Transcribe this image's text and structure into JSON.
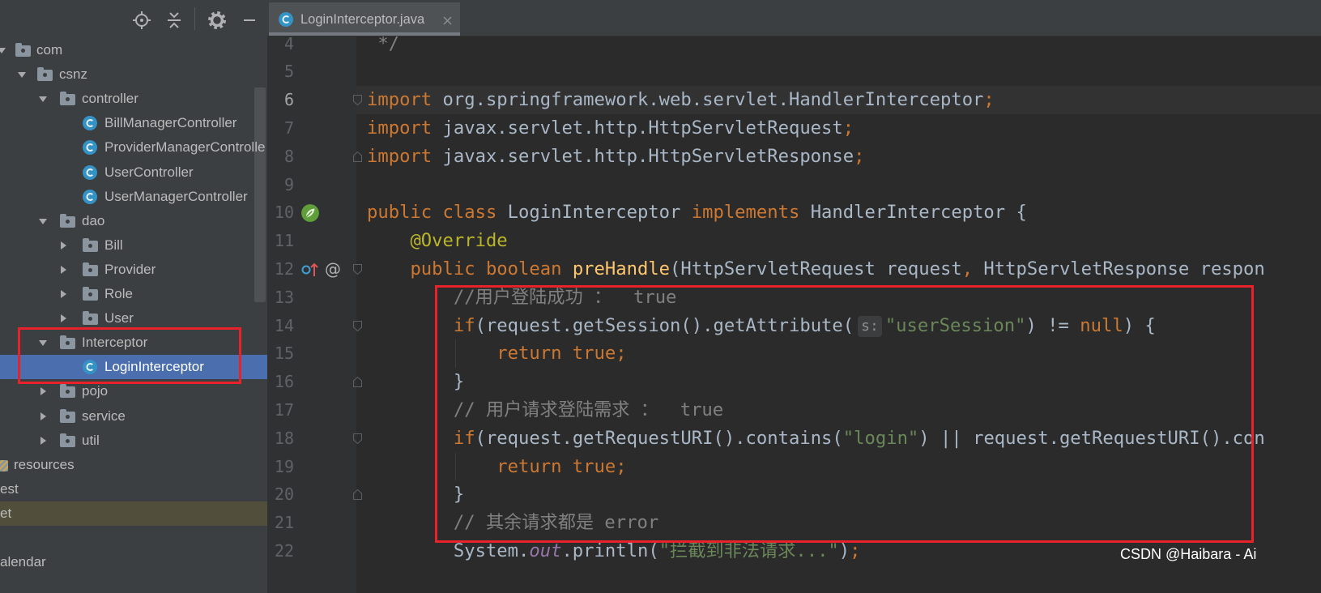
{
  "colors": {
    "keyword": "#cc7832",
    "plain": "#a9b7c6",
    "string": "#6a8759",
    "comment": "#808080",
    "annotation": "#bbb529",
    "method_decl": "#ffc66d",
    "static_field": "#9876aa",
    "selection": "#4b6eaf",
    "highlight_box": "#e8222b"
  },
  "project_panel": {
    "toolbar_icons": [
      "locate-icon",
      "collapse-all-icon",
      "gear-icon",
      "hide-icon"
    ],
    "tree": [
      {
        "label": "com",
        "kind": "package",
        "depth": 0,
        "expanded": true
      },
      {
        "label": "csnz",
        "kind": "package",
        "depth": 1,
        "expanded": true
      },
      {
        "label": "controller",
        "kind": "package",
        "depth": 2,
        "expanded": true
      },
      {
        "label": "BillManagerController",
        "kind": "class",
        "depth": 3
      },
      {
        "label": "ProviderManagerControlle",
        "kind": "class",
        "depth": 3
      },
      {
        "label": "UserController",
        "kind": "class",
        "depth": 3
      },
      {
        "label": "UserManagerController",
        "kind": "class",
        "depth": 3
      },
      {
        "label": "dao",
        "kind": "package",
        "depth": 2,
        "expanded": true
      },
      {
        "label": "Bill",
        "kind": "package",
        "depth": 3,
        "expanded": false
      },
      {
        "label": "Provider",
        "kind": "package",
        "depth": 3,
        "expanded": false
      },
      {
        "label": "Role",
        "kind": "package",
        "depth": 3,
        "expanded": false
      },
      {
        "label": "User",
        "kind": "package",
        "depth": 3,
        "expanded": false
      },
      {
        "label": "Interceptor",
        "kind": "package",
        "depth": 2,
        "expanded": true
      },
      {
        "label": "LoginInterceptor",
        "kind": "class",
        "depth": 3,
        "selected": true
      },
      {
        "label": "pojo",
        "kind": "package",
        "depth": 2,
        "expanded": false
      },
      {
        "label": "service",
        "kind": "package",
        "depth": 2,
        "expanded": false
      },
      {
        "label": "util",
        "kind": "package",
        "depth": 2,
        "expanded": false
      },
      {
        "label": "resources",
        "kind": "resources-folder",
        "depth": -1
      },
      {
        "label": "est",
        "kind": "folder",
        "depth": -2
      },
      {
        "label": "et",
        "kind": "folder",
        "depth": -3,
        "highlighted": true
      },
      {
        "label": "alendar",
        "kind": "folder",
        "depth": -3
      }
    ]
  },
  "editor": {
    "tab": {
      "title": "LoginInterceptor.java",
      "icon": "class-icon",
      "close_icon": "close-icon"
    },
    "current_line": 6,
    "lines": [
      {
        "n": 4,
        "tokens": [
          {
            "t": " */",
            "k": "comment"
          }
        ]
      },
      {
        "n": 5,
        "tokens": []
      },
      {
        "n": 6,
        "fold": "start",
        "tokens": [
          {
            "t": "import",
            "k": "keyword"
          },
          {
            "t": " org.springframework.web.servlet.HandlerInterceptor",
            "k": "plain"
          },
          {
            "t": ";",
            "k": "keyword"
          }
        ]
      },
      {
        "n": 7,
        "tokens": [
          {
            "t": "import",
            "k": "keyword"
          },
          {
            "t": " javax.servlet.http.HttpServletRequest",
            "k": "plain"
          },
          {
            "t": ";",
            "k": "keyword"
          }
        ]
      },
      {
        "n": 8,
        "fold": "end",
        "tokens": [
          {
            "t": "import",
            "k": "keyword"
          },
          {
            "t": " javax.servlet.http.HttpServletResponse",
            "k": "plain"
          },
          {
            "t": ";",
            "k": "keyword"
          }
        ]
      },
      {
        "n": 9,
        "tokens": []
      },
      {
        "n": 10,
        "gutter": [
          {
            "icon": "spring-bean-icon"
          }
        ],
        "tokens": [
          {
            "t": "public class",
            "k": "keyword"
          },
          {
            "t": " LoginInterceptor ",
            "k": "plain"
          },
          {
            "t": "implements",
            "k": "keyword"
          },
          {
            "t": " HandlerInterceptor {",
            "k": "plain"
          }
        ]
      },
      {
        "n": 11,
        "tokens": [
          {
            "t": "    ",
            "k": "plain"
          },
          {
            "t": "@Override",
            "k": "annotation"
          }
        ]
      },
      {
        "n": 12,
        "fold": "start",
        "gutter": [
          {
            "icon": "implements-icon"
          },
          {
            "icon": "override-icon",
            "glyph": "@"
          }
        ],
        "tokens": [
          {
            "t": "    ",
            "k": "plain"
          },
          {
            "t": "public boolean",
            "k": "keyword"
          },
          {
            "t": " ",
            "k": "plain"
          },
          {
            "t": "preHandle",
            "k": "method_decl"
          },
          {
            "t": "(HttpServletRequest request",
            "k": "plain"
          },
          {
            "t": ",",
            "k": "keyword"
          },
          {
            "t": " HttpServletResponse respon",
            "k": "plain"
          }
        ]
      },
      {
        "n": 13,
        "tokens": [
          {
            "t": "        ",
            "k": "plain"
          },
          {
            "t": "//用户登陆成功 ：  true",
            "k": "comment"
          }
        ]
      },
      {
        "n": 14,
        "fold": "start",
        "tokens": [
          {
            "t": "        ",
            "k": "plain"
          },
          {
            "t": "if",
            "k": "keyword"
          },
          {
            "t": "(request.getSession().getAttribute(",
            "k": "plain"
          },
          {
            "t": "s:",
            "k": "hint"
          },
          {
            "t": "\"userSession\"",
            "k": "string"
          },
          {
            "t": ") != ",
            "k": "plain"
          },
          {
            "t": "null",
            "k": "keyword"
          },
          {
            "t": ") {",
            "k": "plain"
          }
        ]
      },
      {
        "n": 15,
        "tokens": [
          {
            "t": "            ",
            "k": "plain"
          },
          {
            "t": "return true;",
            "k": "keyword"
          }
        ]
      },
      {
        "n": 16,
        "fold": "end",
        "tokens": [
          {
            "t": "        }",
            "k": "plain"
          }
        ]
      },
      {
        "n": 17,
        "tokens": [
          {
            "t": "        ",
            "k": "plain"
          },
          {
            "t": "// 用户请求登陆需求 ：  true",
            "k": "comment"
          }
        ]
      },
      {
        "n": 18,
        "fold": "start",
        "tokens": [
          {
            "t": "        ",
            "k": "plain"
          },
          {
            "t": "if",
            "k": "keyword"
          },
          {
            "t": "(request.getRequestURI().contains(",
            "k": "plain"
          },
          {
            "t": "\"login\"",
            "k": "string"
          },
          {
            "t": ") || request.getRequestURI().con",
            "k": "plain"
          }
        ]
      },
      {
        "n": 19,
        "tokens": [
          {
            "t": "            ",
            "k": "plain"
          },
          {
            "t": "return true;",
            "k": "keyword"
          }
        ]
      },
      {
        "n": 20,
        "fold": "end",
        "tokens": [
          {
            "t": "        }",
            "k": "plain"
          }
        ]
      },
      {
        "n": 21,
        "tokens": [
          {
            "t": "        ",
            "k": "plain"
          },
          {
            "t": "// 其余请求都是 error",
            "k": "comment"
          }
        ]
      },
      {
        "n": 22,
        "tokens": [
          {
            "t": "        System.",
            "k": "plain"
          },
          {
            "t": "out",
            "k": "static_field"
          },
          {
            "t": ".println(",
            "k": "plain"
          },
          {
            "t": "\"拦截到非法请求...\"",
            "k": "string"
          },
          {
            "t": ")",
            "k": "plain"
          },
          {
            "t": ";",
            "k": "keyword"
          }
        ]
      }
    ]
  },
  "watermark": "CSDN @Haibara - Ai"
}
